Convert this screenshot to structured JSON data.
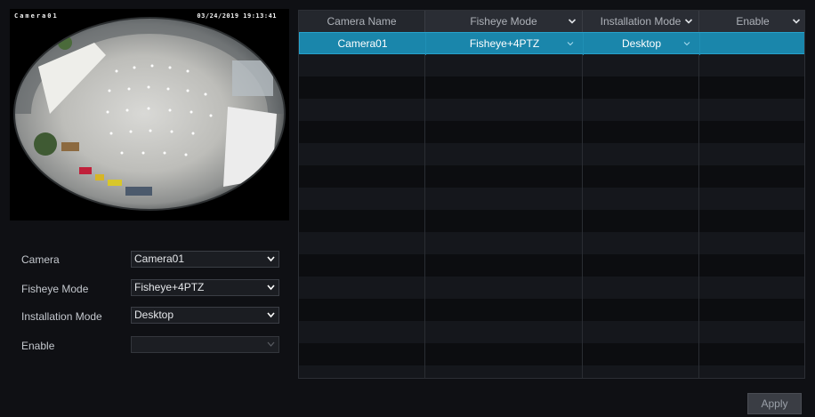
{
  "preview": {
    "osd_name": "Camera01",
    "osd_timestamp": "03/24/2019 19:13:41"
  },
  "form": {
    "camera": {
      "label": "Camera",
      "value": "Camera01"
    },
    "fisheye_mode": {
      "label": "Fisheye Mode",
      "value": "Fisheye+4PTZ"
    },
    "installation_mode": {
      "label": "Installation Mode",
      "value": "Desktop"
    },
    "enable": {
      "label": "Enable",
      "value": ""
    }
  },
  "table": {
    "columns": [
      "Camera Name",
      "Fisheye Mode",
      "Installation Mode",
      "Enable"
    ],
    "rows": [
      {
        "camera_name": "Camera01",
        "fisheye_mode": "Fisheye+4PTZ",
        "installation_mode": "Desktop",
        "enable": ""
      }
    ]
  },
  "actions": {
    "apply_label": "Apply"
  },
  "colors": {
    "selected_row": "#1a86ab",
    "background": "#0f1014",
    "header": "#24272d"
  }
}
